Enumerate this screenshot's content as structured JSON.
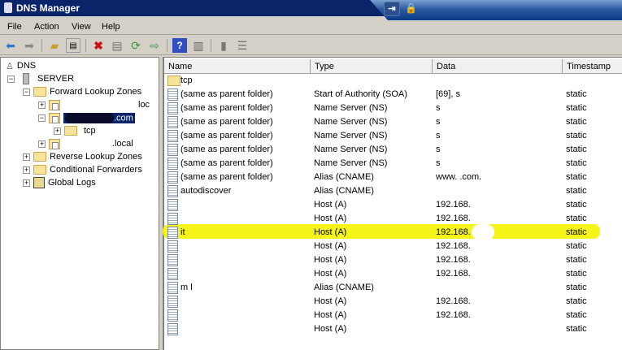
{
  "window": {
    "title": "DNS Manager"
  },
  "menu": [
    "File",
    "Action",
    "View",
    "Help"
  ],
  "toolbar": [
    "back-icon",
    "forward-icon",
    "up-folder-icon",
    "show-hide-tree-icon",
    "delete-icon",
    "properties-icon",
    "refresh-icon",
    "export-icon",
    "help-icon",
    "action-pane-icon",
    "server-icon",
    "list-icon"
  ],
  "tree": {
    "root": "DNS",
    "server": "SERVER",
    "forward": "Forward Lookup Zones",
    "zone1": "loc",
    "zone2": ".com",
    "zone2_child": "tcp",
    "zone3": ".local",
    "reverse": "Reverse Lookup Zones",
    "conditional": "Conditional Forwarders",
    "global_logs": "Global Logs"
  },
  "columns": [
    "Name",
    "Type",
    "Data",
    "Timestamp"
  ],
  "rows": [
    {
      "name": "tcp",
      "type": "",
      "data": "",
      "ts": "",
      "kind": "folder"
    },
    {
      "name": "(same as parent folder)",
      "type": "Start of Authority (SOA)",
      "data": "[69], s",
      "ts": "static"
    },
    {
      "name": "(same as parent folder)",
      "type": "Name Server (NS)",
      "data": "s",
      "ts": "static"
    },
    {
      "name": "(same as parent folder)",
      "type": "Name Server (NS)",
      "data": "s",
      "ts": "static"
    },
    {
      "name": "(same as parent folder)",
      "type": "Name Server (NS)",
      "data": "s",
      "ts": "static"
    },
    {
      "name": "(same as parent folder)",
      "type": "Name Server (NS)",
      "data": "s",
      "ts": "static"
    },
    {
      "name": "(same as parent folder)",
      "type": "Name Server (NS)",
      "data": "s",
      "ts": "static"
    },
    {
      "name": "(same as parent folder)",
      "type": "Alias (CNAME)",
      "data": "www.            .com.",
      "ts": "static"
    },
    {
      "name": "autodiscover",
      "type": "Alias (CNAME)",
      "data": "",
      "ts": "static"
    },
    {
      "name": "",
      "type": "Host (A)",
      "data": "192.168.",
      "ts": "static"
    },
    {
      "name": "",
      "type": "Host (A)",
      "data": "192.168.",
      "ts": "static"
    },
    {
      "name": "it",
      "type": "Host (A)",
      "data": "192.168.",
      "ts": "static"
    },
    {
      "name": "",
      "type": "Host (A)",
      "data": "192.168.",
      "ts": "static"
    },
    {
      "name": "",
      "type": "Host (A)",
      "data": "192.168.",
      "ts": "static"
    },
    {
      "name": "",
      "type": "Host (A)",
      "data": "192.168.",
      "ts": "static"
    },
    {
      "name": "m  l",
      "type": "Alias (CNAME)",
      "data": "",
      "ts": "static"
    },
    {
      "name": "",
      "type": "Host (A)",
      "data": "192.168.",
      "ts": "static"
    },
    {
      "name": "",
      "type": "Host (A)",
      "data": "192.168.",
      "ts": "static"
    },
    {
      "name": "",
      "type": "Host (A)",
      "data": "",
      "ts": "static"
    }
  ],
  "colors": {
    "titlebar": "#0a246a",
    "highlight": "#f4f400"
  }
}
